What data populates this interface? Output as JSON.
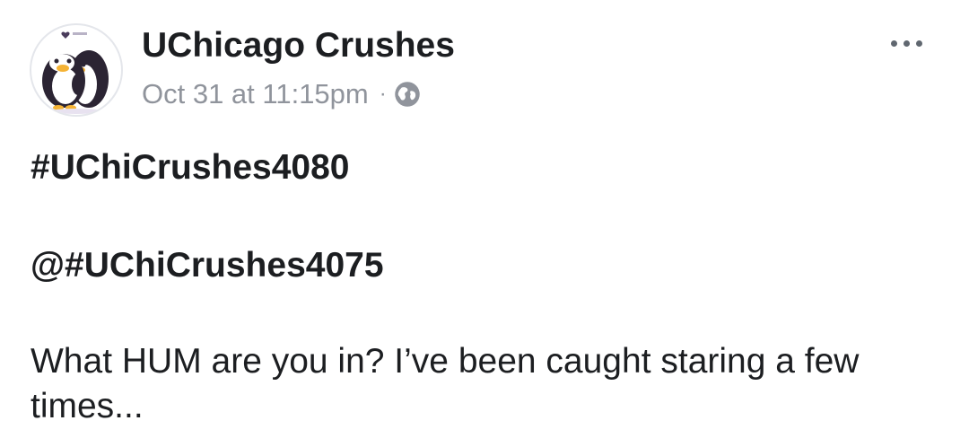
{
  "post": {
    "page_name": "UChicago Crushes",
    "timestamp": "Oct 31 at 11:15pm",
    "separator": "·",
    "privacy_icon": "globe-icon",
    "more_icon": "more-options-icon",
    "avatar_icon": "penguins-logo",
    "hashtag": "#UChiCrushes4080",
    "reply_tag": "@#UChiCrushes4075",
    "message": "What HUM are you in? I’ve been caught staring a few times..."
  },
  "colors": {
    "text": "#1c1e21",
    "meta": "#90949c",
    "icon": "#606770",
    "background": "#ffffff"
  }
}
